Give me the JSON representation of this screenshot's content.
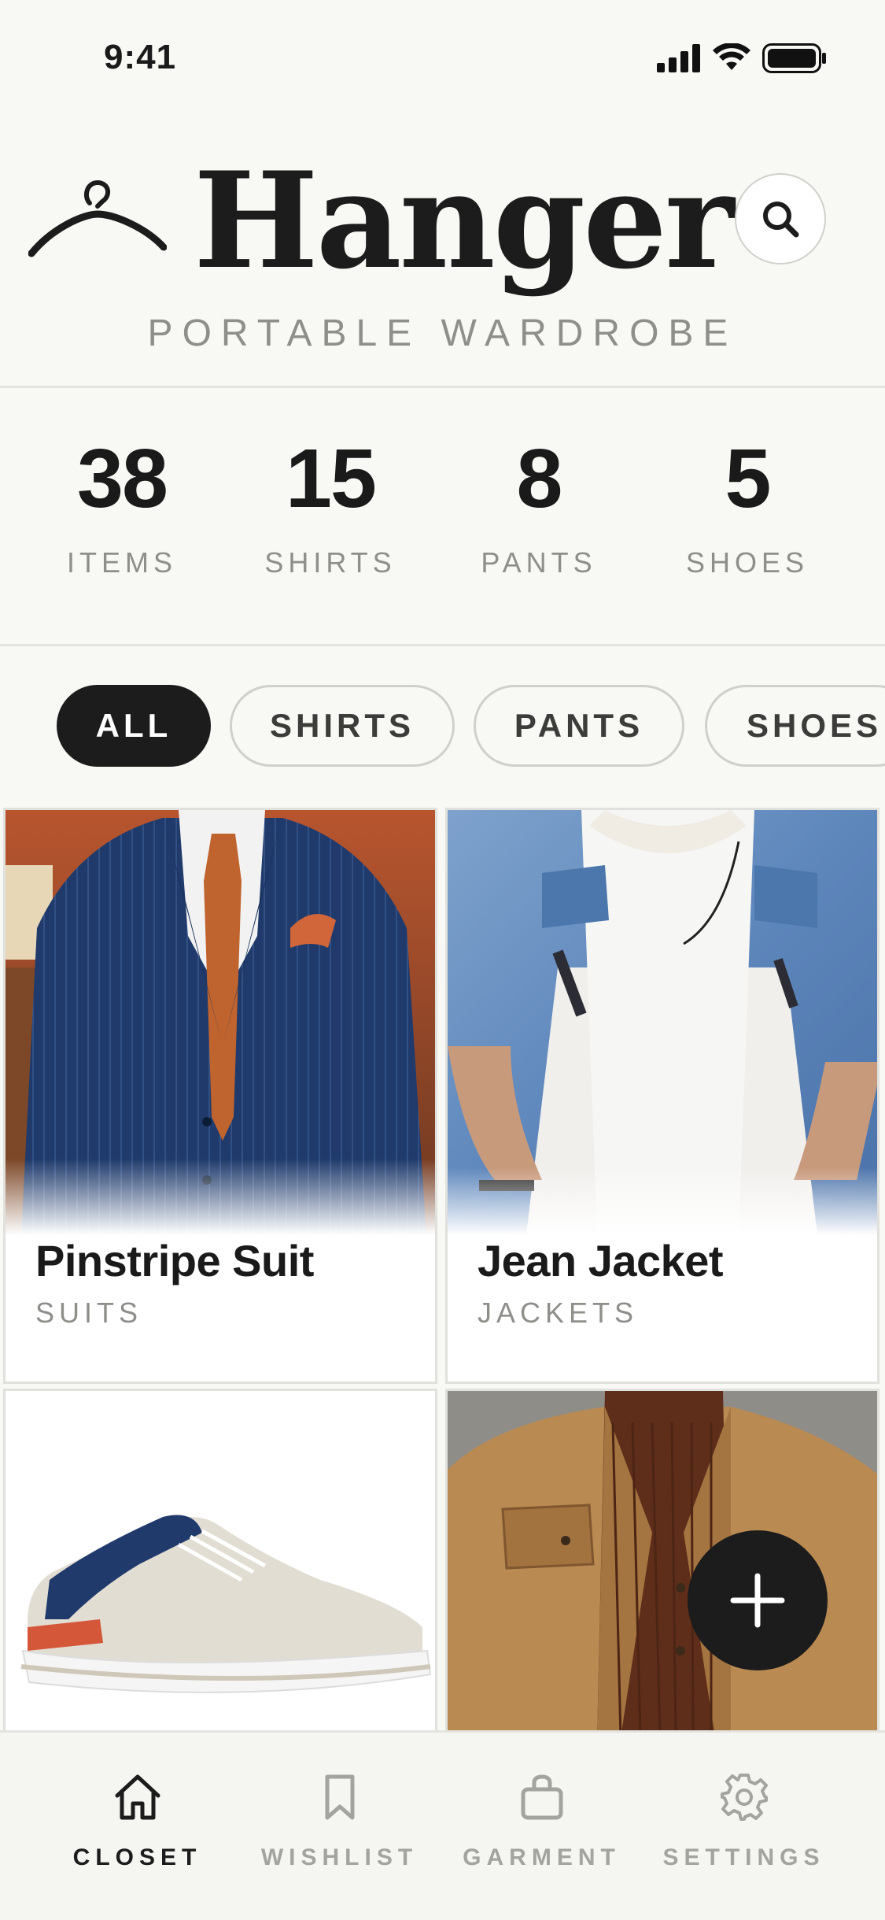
{
  "status_bar": {
    "time": "9:41"
  },
  "header": {
    "brand": "Hanger",
    "tagline": "PORTABLE WARDROBE",
    "search_icon": "search-icon"
  },
  "stats": [
    {
      "value": "38",
      "label": "ITEMS"
    },
    {
      "value": "15",
      "label": "SHIRTS"
    },
    {
      "value": "8",
      "label": "PANTS"
    },
    {
      "value": "5",
      "label": "SHOES"
    }
  ],
  "filters": [
    {
      "label": "ALL",
      "active": true
    },
    {
      "label": "SHIRTS",
      "active": false
    },
    {
      "label": "PANTS",
      "active": false
    },
    {
      "label": "SHOES",
      "active": false
    }
  ],
  "items": [
    {
      "name": "Pinstripe Suit",
      "category": "SUITS"
    },
    {
      "name": "Jean Jacket",
      "category": "JACKETS"
    },
    {
      "name": "",
      "category": ""
    },
    {
      "name": "",
      "category": ""
    }
  ],
  "fab": {
    "icon": "plus-icon"
  },
  "nav": [
    {
      "label": "CLOSET",
      "icon": "home-icon",
      "active": true
    },
    {
      "label": "WISHLIST",
      "icon": "bookmark-icon",
      "active": false
    },
    {
      "label": "GARMENT",
      "icon": "bag-icon",
      "active": false
    },
    {
      "label": "SETTINGS",
      "icon": "gear-icon",
      "active": false
    }
  ],
  "colors": {
    "accent": "#1c1c1c",
    "background": "#f8f8f5",
    "muted": "#8e8e8b"
  }
}
